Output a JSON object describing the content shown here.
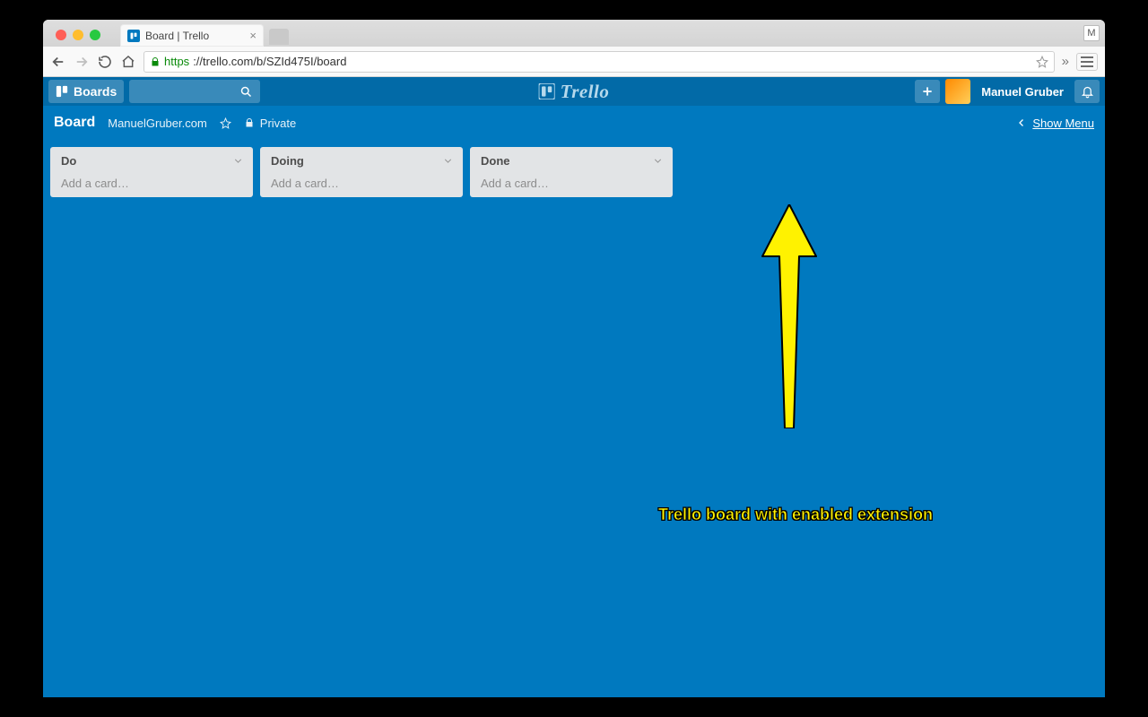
{
  "browser": {
    "profile_initial": "M",
    "tab_title": "Board | Trello",
    "url_https": "https",
    "url_rest": "://trello.com/b/SZId475I/board"
  },
  "trello_header": {
    "boards_label": "Boards",
    "logo_text": "Trello",
    "user_name": "Manuel Gruber"
  },
  "board_bar": {
    "board_name": "Board",
    "team_name": "ManuelGruber.com",
    "visibility": "Private",
    "show_menu": "Show Menu"
  },
  "lists": [
    {
      "name": "Do",
      "add_placeholder": "Add a card…"
    },
    {
      "name": "Doing",
      "add_placeholder": "Add a card…"
    },
    {
      "name": "Done",
      "add_placeholder": "Add a card…"
    }
  ],
  "annotation": {
    "caption": "Trello board with enabled extension"
  }
}
